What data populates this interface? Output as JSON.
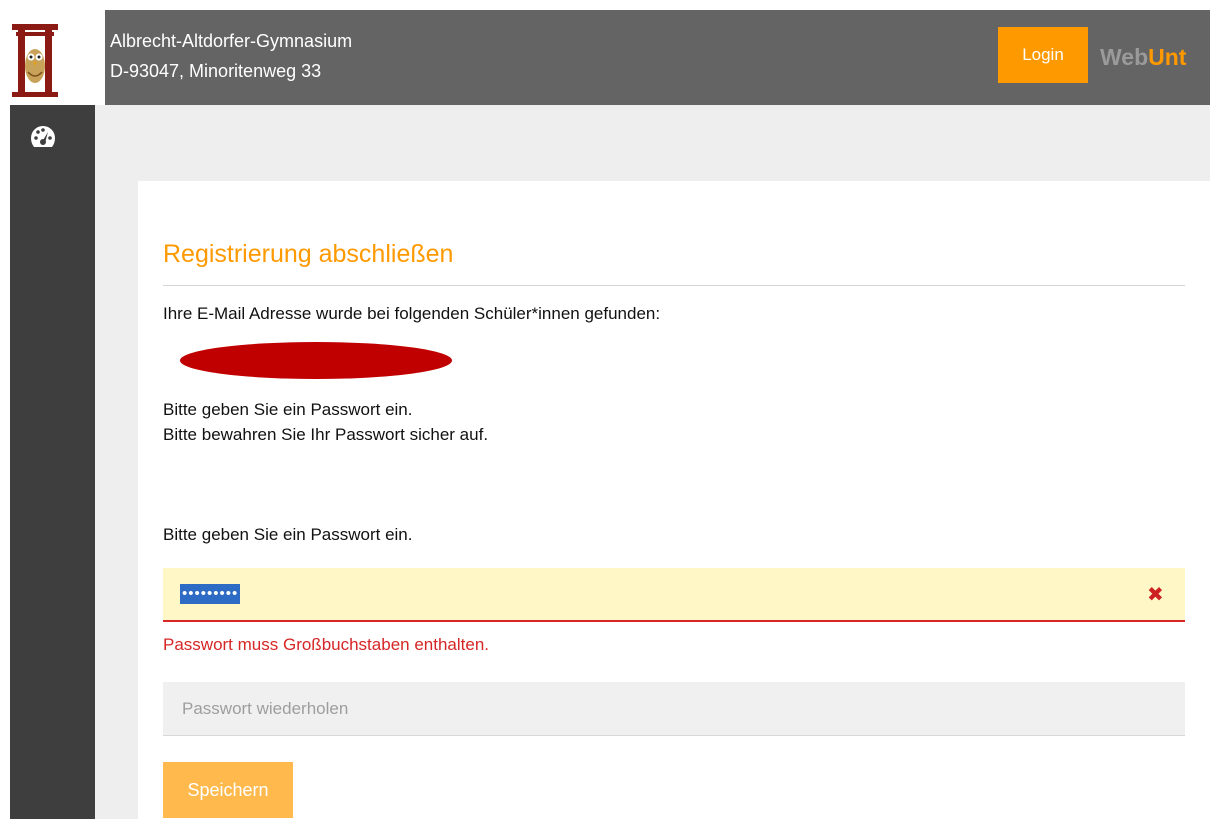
{
  "header": {
    "school_name": "Albrecht-Altdorfer-Gymnasium",
    "school_address": "D-93047, Minoritenweg 33",
    "login_label": "Login",
    "brand_part1": "Web",
    "brand_part2": "Unt",
    "background_color": "#646464",
    "accent_color": "#ff9900"
  },
  "sidebar": {
    "items": [
      {
        "icon": "dashboard-icon"
      }
    ],
    "background_color": "#3e3e3e"
  },
  "main": {
    "title": "Registrierung abschließen",
    "found_text": "Ihre E-Mail Adresse wurde bei folgenden Schüler*innen gefunden:",
    "info_line1": "Bitte geben Sie ein Passwort ein.",
    "info_line2": "Bitte bewahren Sie Ihr Passwort sicher auf.",
    "password_label": "Bitte geben Sie ein Passwort ein.",
    "password_value": "•••••••••",
    "password_error": "Passwort muss Großbuchstaben enthalten.",
    "repeat_placeholder": "Passwort wiederholen",
    "save_label": "Speichern",
    "error_color": "#d62626"
  }
}
